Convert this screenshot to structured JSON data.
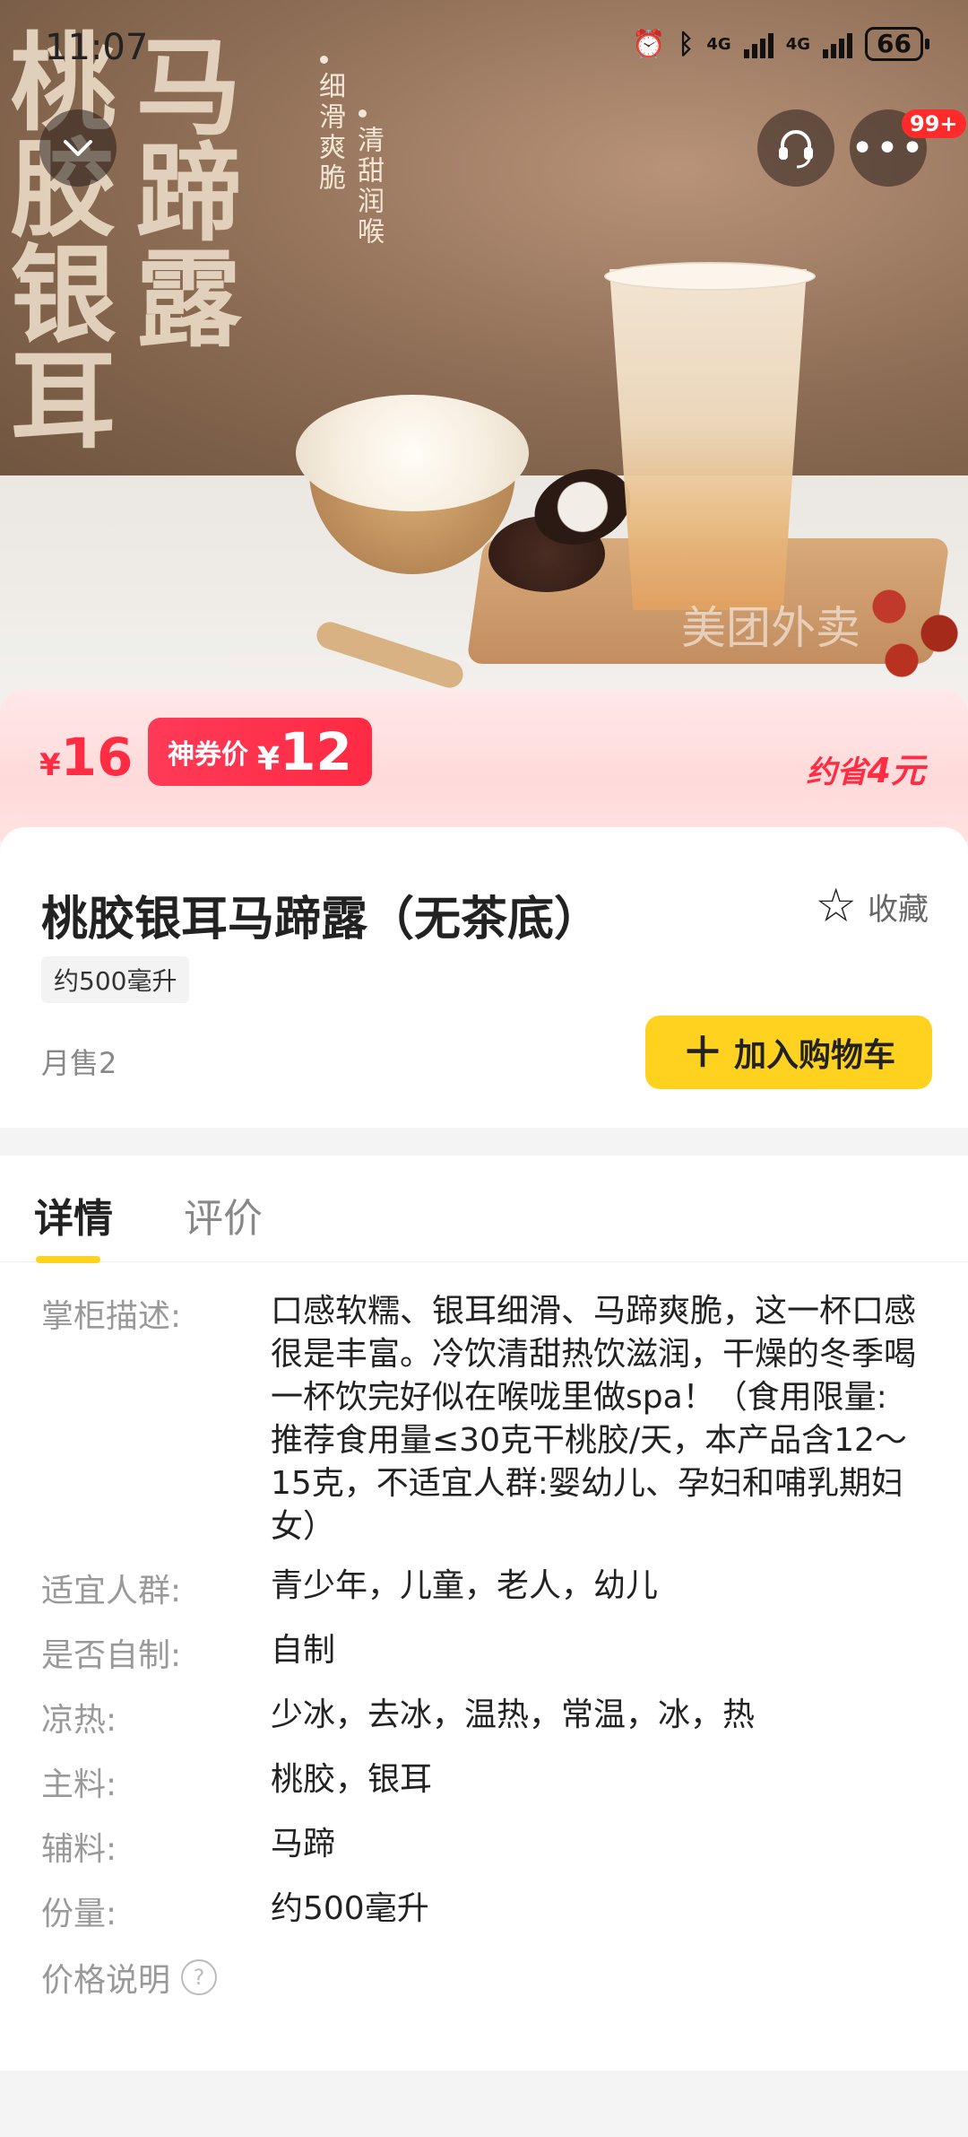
{
  "status_bar": {
    "time": "11:07",
    "signal1": "4G",
    "signal2": "4G",
    "battery": "66"
  },
  "hero": {
    "title_col1": "桃胶银耳",
    "title_col2": "马蹄露",
    "slogan1": "细滑爽脆",
    "slogan2": "清甜润喉",
    "watermark": "美团外卖",
    "more_badge": "99+"
  },
  "price": {
    "currency": "¥",
    "original": "16",
    "coupon_label": "神券价",
    "coupon_price": "12",
    "save_label": "约省",
    "save_amount": "4元"
  },
  "product": {
    "name": "桃胶银耳马蹄露（无茶底）",
    "favorite_label": "收藏",
    "spec": "约500毫升",
    "sales": "月售2",
    "add_cart_label": "加入购物车"
  },
  "tabs": [
    {
      "label": "详情"
    },
    {
      "label": "评价"
    }
  ],
  "details": {
    "rows": [
      {
        "key": "掌柜描述:",
        "value": "口感软糯、银耳细滑、马蹄爽脆，这一杯口感很是丰富。冷饮清甜热饮滋润，干燥的冬季喝一杯饮完好似在喉咙里做spa！（食用限量:推荐食用量≤30克干桃胶/天，本产品含12～15克，不适宜人群:婴幼儿、孕妇和哺乳期妇女）"
      },
      {
        "key": "适宜人群:",
        "value": "青少年，儿童，老人，幼儿"
      },
      {
        "key": "是否自制:",
        "value": "自制"
      },
      {
        "key": "凉热:",
        "value": "少冰，去冰，温热，常温，冰，热"
      },
      {
        "key": "主料:",
        "value": "桃胶，银耳"
      },
      {
        "key": "辅料:",
        "value": "马蹄"
      },
      {
        "key": "份量:",
        "value": "约500毫升"
      }
    ],
    "price_note": "价格说明",
    "help_mark": "?"
  }
}
